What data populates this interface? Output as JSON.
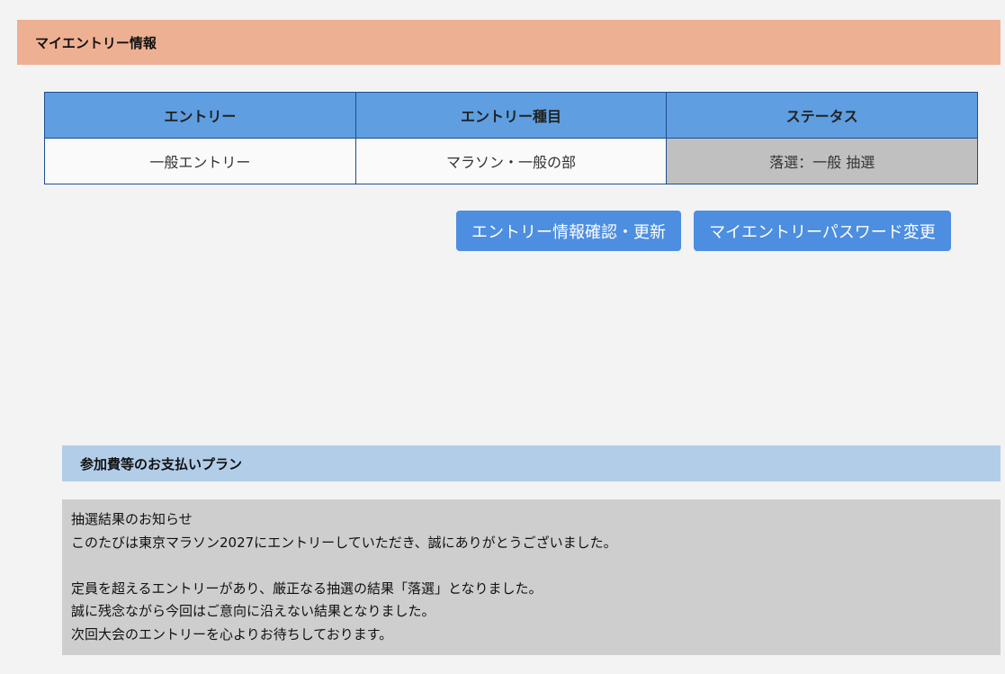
{
  "my_entry": {
    "title": "マイエントリー情報",
    "table": {
      "headers": [
        "エントリー",
        "エントリー種目",
        "ステータス"
      ],
      "rows": [
        [
          "一般エントリー",
          "マラソン・一般の部",
          "落選：一般 抽選"
        ]
      ]
    },
    "buttons": {
      "entry_info": "エントリー情報確認・更新",
      "password_change": "マイエントリーパスワード変更"
    }
  },
  "payment_plan": {
    "title": "参加費等のお支払いプラン",
    "notice": {
      "lines": [
        "抽選結果のお知らせ",
        "このたびは東京マラソン2027にエントリーしていただき、誠にありがとうございました。",
        "",
        "定員を超えるエントリーがあり、厳正なる抽選の結果「落選」となりました。",
        "誠に残念ながら今回はご意向に沿えない結果となりました。",
        "次回大会のエントリーを心よりお待ちしております。"
      ]
    }
  },
  "colors": {
    "section_header_bg": "#eeb092",
    "table_header_bg": "#5f9ee0",
    "status_cell_bg": "#c0c0c0",
    "button_bg": "#4d8ee0",
    "plan_header_bg": "#b2cde8",
    "notice_bg": "#cecece"
  }
}
